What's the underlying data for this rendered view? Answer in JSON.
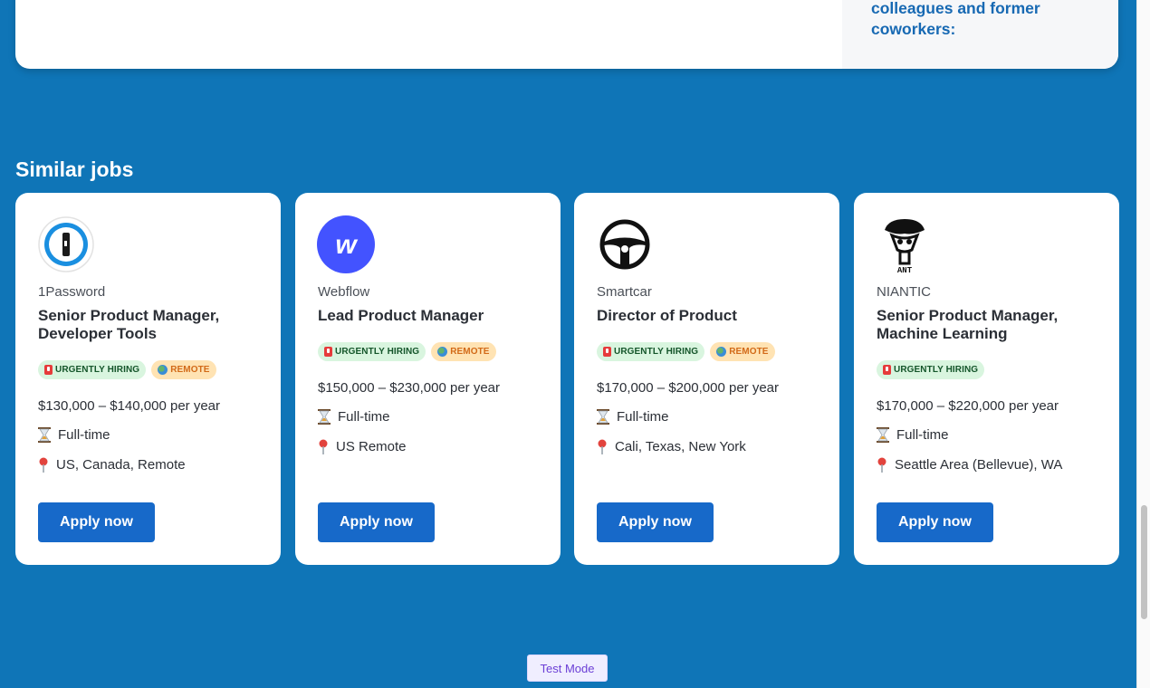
{
  "top_card": {
    "side_text": "colleagues and former coworkers:"
  },
  "section": {
    "title": "Similar jobs"
  },
  "jobs": [
    {
      "company": "1Password",
      "title": "Senior Product Manager, Developer Tools",
      "badges": [
        "URGENTLY HIRING",
        "REMOTE"
      ],
      "salary": "$130,000 – $140,000 per year",
      "type": "Full-time",
      "location": "US, Canada, Remote",
      "apply": "Apply now"
    },
    {
      "company": "Webflow",
      "title": "Lead Product Manager",
      "badges": [
        "URGENTLY HIRING",
        "REMOTE"
      ],
      "salary": "$150,000 – $230,000 per year",
      "type": "Full-time",
      "location": "US Remote",
      "apply": "Apply now"
    },
    {
      "company": "Smartcar",
      "title": "Director of Product",
      "badges": [
        "URGENTLY HIRING",
        "REMOTE"
      ],
      "salary": "$170,000 – $200,000 per year",
      "type": "Full-time",
      "location": "Cali, Texas, New York",
      "apply": "Apply now"
    },
    {
      "company": "NIANTIC",
      "title": "Senior Product Manager, Machine Learning",
      "badges": [
        "URGENTLY HIRING"
      ],
      "salary": "$170,000 – $220,000 per year",
      "type": "Full-time",
      "location": "Seattle Area (Bellevue), WA",
      "apply": "Apply now"
    }
  ],
  "logo_text": {
    "niantic": "ANT",
    "webflow": "w"
  },
  "footer": {
    "test_mode": "Test Mode"
  },
  "icons": {
    "hourglass": "hourglass-icon",
    "pin": "location-pin-icon",
    "urgent": "siren-icon",
    "remote": "globe-icon"
  },
  "colors": {
    "page_bg": "#0f75b7",
    "apply_button": "#1769c9",
    "urgent_badge_bg": "#d9f5df",
    "remote_badge_bg": "#ffe3b3",
    "side_text": "#1769b3"
  }
}
